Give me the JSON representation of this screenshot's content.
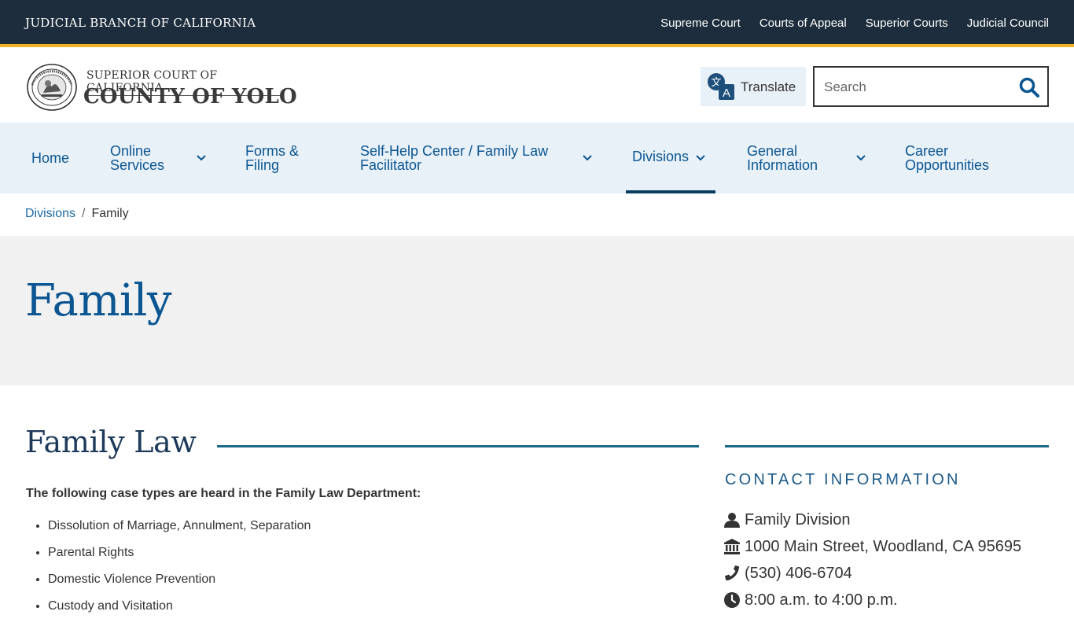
{
  "topbar": {
    "brand": "JUDICIAL BRANCH OF CALIFORNIA",
    "links": [
      "Supreme Court",
      "Courts of Appeal",
      "Superior Courts",
      "Judicial Council"
    ]
  },
  "header": {
    "logo_top": "SUPERIOR COURT OF CALIFORNIA",
    "logo_bottom": "COUNTY OF YOLO",
    "seal_text": "JUDICIAL BRANCH OF CALIFORNIA",
    "translate_label": "Translate",
    "search_placeholder": "Search"
  },
  "nav": {
    "home": "Home",
    "online_services": "Online Services",
    "forms_filing": "Forms & Filing",
    "self_help": "Self-Help Center / Family Law Facilitator",
    "divisions": "Divisions",
    "general_info": "General Information",
    "careers": "Career Opportunities"
  },
  "breadcrumb": {
    "parent": "Divisions",
    "separator": "/",
    "current": "Family"
  },
  "hero": {
    "title": "Family"
  },
  "main": {
    "section_title": "Family Law",
    "intro": "The following case types are heard in the Family Law Department:",
    "case_types": [
      "Dissolution of Marriage, Annulment, Separation",
      "Parental Rights",
      "Domestic Violence Prevention",
      "Custody and Visitation"
    ]
  },
  "sidebar": {
    "title": "CONTACT INFORMATION",
    "division": "Family Division",
    "address": "1000 Main Street, Woodland, CA 95695",
    "phone": "(530) 406-6704",
    "hours": "8:00 a.m. to 4:00 p.m."
  },
  "colors": {
    "topbar_bg": "#1e2d3d",
    "accent_gold": "#f0b323",
    "nav_bg": "#e8f0f8",
    "link_blue": "#0b5692",
    "rule_teal": "#1c6a8a"
  }
}
